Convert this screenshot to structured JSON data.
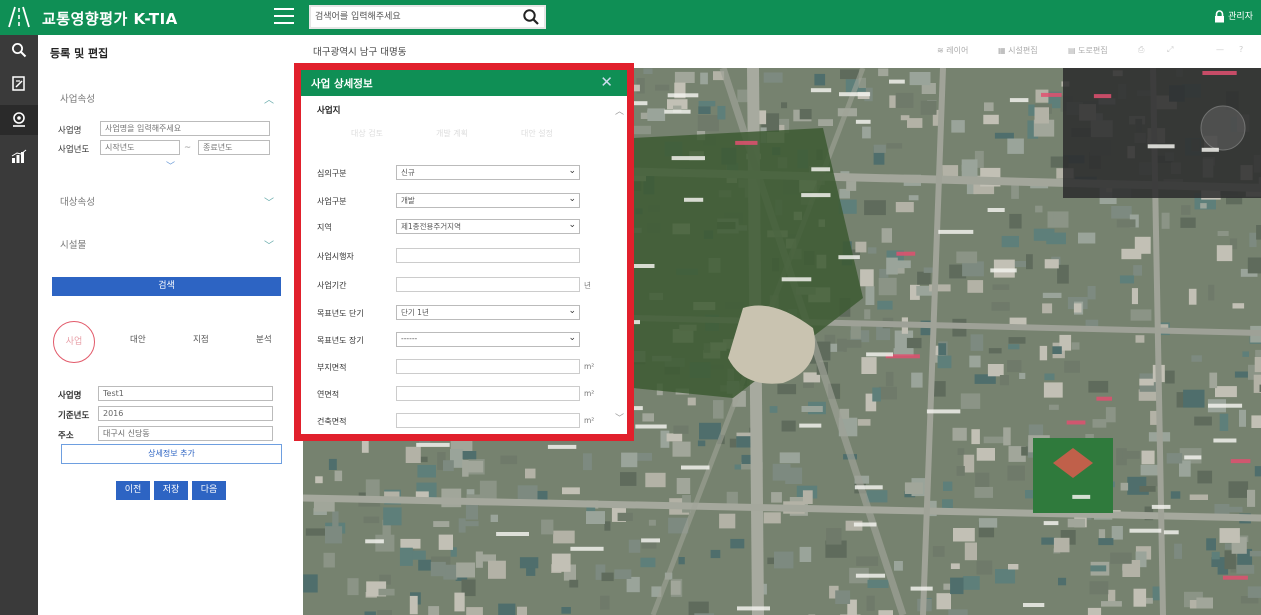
{
  "header": {
    "title": "교통영향평가 K-TIA",
    "search": {
      "placeholder": "검색어를 입력해주세요"
    },
    "user_label": "관리자"
  },
  "icons": {
    "logo": "road-logo-icon",
    "menu": "hamburger-menu-icon",
    "search": "search-icon",
    "user": "lock-icon",
    "rail": [
      "search-icon",
      "edit-document-icon",
      "map-pin-icon",
      "bar-chart-icon"
    ]
  },
  "colors": {
    "brand_green": "#0f8f55",
    "rail_dark": "#3a3a3a",
    "primary_button": "#2d64c3",
    "highlight_frame": "#e1202c"
  },
  "panel": {
    "title": "등록 및 편집",
    "sections": {
      "business": "사업속성",
      "target": "대상속성",
      "facility": "시설물"
    },
    "business_name_label": "사업명",
    "business_name_placeholder": "사업명을 입력해주세요",
    "business_year_label": "사업년도",
    "start_year_placeholder": "시작년도",
    "year_separator": "~",
    "end_year_placeholder": "종료년도",
    "search_button": "검색",
    "steps": [
      "사업",
      "대안",
      "지점",
      "분석"
    ],
    "result_name_label": "사업명",
    "result_name_value": "Test1",
    "result_year_label": "기준년도",
    "result_year_value": "2016",
    "result_addr_label": "주소",
    "result_addr_value": "대구시 신당동",
    "add_detail_button": "상세정보 추가",
    "actions": [
      "이전",
      "저장",
      "다음"
    ]
  },
  "map": {
    "location": "대구광역시 남구 대명동",
    "tools": [
      "레이어",
      "시설편집",
      "도로편집"
    ]
  },
  "modal": {
    "title": "사업 상세정보",
    "section": "사업지",
    "faint_tabs": [
      "대상 검토",
      "개발 계획",
      "대안 설정"
    ],
    "fields": [
      {
        "label": "심의구분",
        "type": "select",
        "value": "신규"
      },
      {
        "label": "사업구분",
        "type": "select",
        "value": "개발"
      },
      {
        "label": "지역",
        "type": "select",
        "value": "제1종전용주거지역"
      },
      {
        "label": "사업시행자",
        "type": "input",
        "value": ""
      },
      {
        "label": "사업기간",
        "type": "input",
        "value": "",
        "unit": "년"
      },
      {
        "label": "목표년도 단기",
        "type": "select",
        "value": "단기 1년"
      },
      {
        "label": "목표년도 장기",
        "type": "select",
        "value": "------"
      },
      {
        "label": "부지면적",
        "type": "input",
        "value": "",
        "unit": "m²"
      },
      {
        "label": "연면적",
        "type": "input",
        "value": "",
        "unit": "m²"
      },
      {
        "label": "건축면적",
        "type": "input",
        "value": "",
        "unit": "m²"
      }
    ]
  }
}
